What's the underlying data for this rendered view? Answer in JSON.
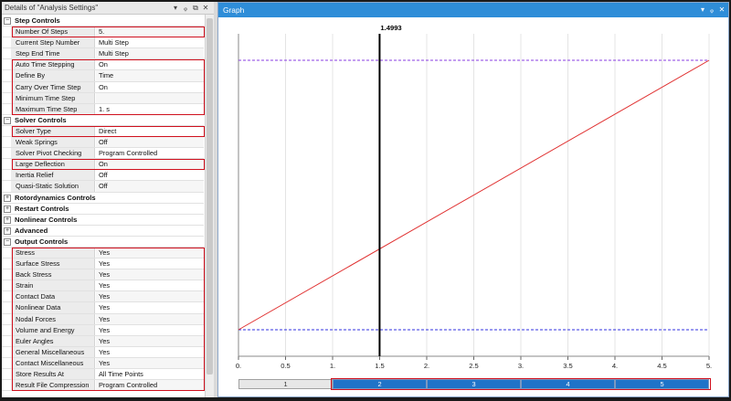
{
  "details": {
    "title": "Details of \"Analysis Settings\"",
    "title_controls": [
      "▾",
      "ᵩ",
      "⧉",
      "✕"
    ],
    "rows": [
      {
        "kind": "cat",
        "toggle": "−",
        "label": "Step Controls"
      },
      {
        "kind": "prop",
        "label": "Number Of Steps",
        "value": "5."
      },
      {
        "kind": "prop",
        "label": "Current Step Number",
        "value": "Multi Step"
      },
      {
        "kind": "prop",
        "label": "Step End Time",
        "value": "Multi Step"
      },
      {
        "kind": "prop",
        "label": "Auto Time Stepping",
        "value": "On"
      },
      {
        "kind": "prop",
        "label": "Define By",
        "value": "Time"
      },
      {
        "kind": "prop",
        "label": "Carry Over Time Step",
        "value": "On"
      },
      {
        "kind": "prop",
        "label": "Minimum Time Step",
        "value": ""
      },
      {
        "kind": "prop",
        "label": "Maximum Time Step",
        "value": "1. s"
      },
      {
        "kind": "cat",
        "toggle": "−",
        "label": "Solver Controls"
      },
      {
        "kind": "prop",
        "label": "Solver Type",
        "value": "Direct"
      },
      {
        "kind": "prop",
        "label": "Weak Springs",
        "value": "Off"
      },
      {
        "kind": "prop",
        "label": "Solver Pivot Checking",
        "value": "Program Controlled"
      },
      {
        "kind": "prop",
        "label": "Large Deflection",
        "value": "On"
      },
      {
        "kind": "prop",
        "label": "Inertia Relief",
        "value": "Off"
      },
      {
        "kind": "prop",
        "label": "Quasi-Static Solution",
        "value": "Off"
      },
      {
        "kind": "cat",
        "toggle": "+",
        "label": "Rotordynamics Controls"
      },
      {
        "kind": "cat",
        "toggle": "+",
        "label": "Restart Controls"
      },
      {
        "kind": "cat",
        "toggle": "+",
        "label": "Nonlinear Controls"
      },
      {
        "kind": "cat",
        "toggle": "+",
        "label": "Advanced"
      },
      {
        "kind": "cat",
        "toggle": "−",
        "label": "Output Controls"
      },
      {
        "kind": "prop",
        "label": "Stress",
        "value": "Yes"
      },
      {
        "kind": "prop",
        "label": "Surface Stress",
        "value": "Yes"
      },
      {
        "kind": "prop",
        "label": "Back Stress",
        "value": "Yes"
      },
      {
        "kind": "prop",
        "label": "Strain",
        "value": "Yes"
      },
      {
        "kind": "prop",
        "label": "Contact Data",
        "value": "Yes"
      },
      {
        "kind": "prop",
        "label": "Nonlinear Data",
        "value": "Yes"
      },
      {
        "kind": "prop",
        "label": "Nodal Forces",
        "value": "Yes"
      },
      {
        "kind": "prop",
        "label": "Volume and Energy",
        "value": "Yes"
      },
      {
        "kind": "prop",
        "label": "Euler Angles",
        "value": "Yes"
      },
      {
        "kind": "prop",
        "label": "General Miscellaneous",
        "value": "Yes"
      },
      {
        "kind": "prop",
        "label": "Contact Miscellaneous",
        "value": "Yes"
      },
      {
        "kind": "prop",
        "label": "Store Results At",
        "value": "All Time Points"
      },
      {
        "kind": "prop",
        "label": "Result File Compression",
        "value": "Program Controlled"
      }
    ]
  },
  "graph": {
    "title": "Graph",
    "title_controls": [
      "▾",
      "ᵩ",
      "✕"
    ],
    "cursor_label": "1.4993",
    "timeline": [
      "1",
      "2",
      "3",
      "4",
      "5"
    ]
  },
  "chart_data": {
    "type": "line",
    "x_tick_labels": [
      "0.",
      "0.5",
      "1.",
      "1.5",
      "2.",
      "2.5",
      "3.",
      "3.5",
      "4.",
      "4.5",
      "5."
    ],
    "xlim": [
      0,
      5
    ],
    "ylim": [
      0,
      1
    ],
    "grid": true,
    "series": [
      {
        "x": [
          0,
          5
        ],
        "y": [
          0.0,
          1.0
        ],
        "color": "#e03030"
      }
    ],
    "reference_lines": [
      {
        "y": 1.0,
        "color": "#8a3ce0",
        "style": "dashed"
      },
      {
        "y": 0.0,
        "color": "#3030e0",
        "style": "dashed"
      }
    ],
    "cursor_x": 1.4993,
    "cursor_color": "#000000"
  }
}
